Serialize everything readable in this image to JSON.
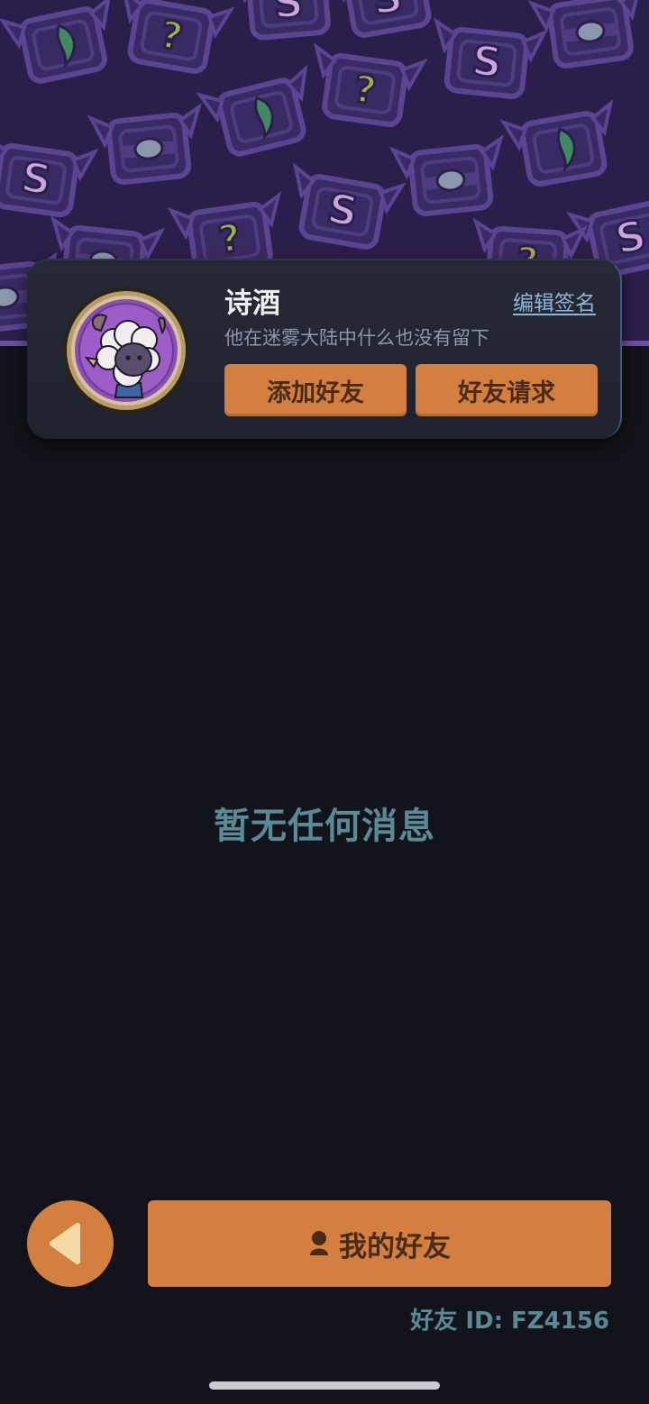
{
  "profile": {
    "name": "诗酒",
    "signature": "他在迷雾大陆中什么也没有留下",
    "edit_signature_label": "编辑签名",
    "add_friend_label": "添加好友",
    "friend_requests_label": "好友请求"
  },
  "main": {
    "empty_message": "暂无任何消息"
  },
  "footer": {
    "my_friends_label": "我的好友",
    "friend_id_text": "好友 ID: FZ4156"
  },
  "icons": {
    "back": "back-arrow-icon",
    "person": "person-icon",
    "avatar": "sheep-avatar",
    "banner_tiles": [
      "s-rune-icon",
      "question-rune-icon",
      "leaf-rune-icon",
      "gem-rune-icon"
    ]
  },
  "colors": {
    "background": "#13141b",
    "banner": "#2b1e4a",
    "accent_orange": "#d27f40",
    "muted_teal": "#5a8a96",
    "link_blue": "#8fb6d8"
  }
}
